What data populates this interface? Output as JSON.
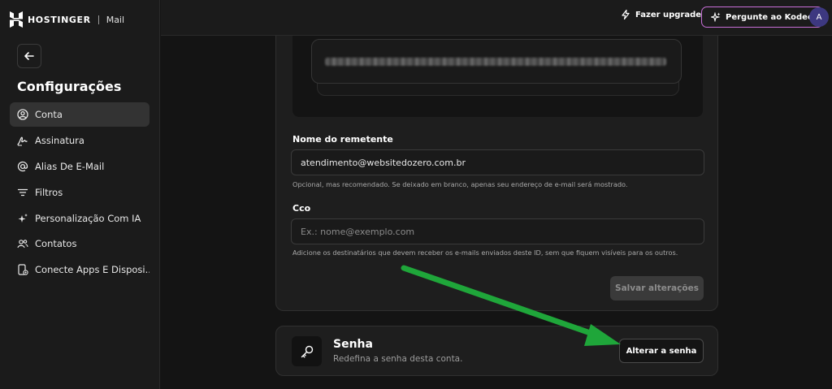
{
  "brand": {
    "name": "HOSTINGER",
    "product": "Mail"
  },
  "sidebar": {
    "title": "Configurações",
    "items": [
      {
        "label": "Conta",
        "icon": "user-circle-icon",
        "active": true
      },
      {
        "label": "Assinatura",
        "icon": "signature-icon",
        "active": false
      },
      {
        "label": "Alias De E-Mail",
        "icon": "at-icon",
        "active": false
      },
      {
        "label": "Filtros",
        "icon": "filter-icon",
        "active": false
      },
      {
        "label": "Personalização Com IA",
        "icon": "sparkles-icon",
        "active": false
      },
      {
        "label": "Contatos",
        "icon": "contacts-icon",
        "active": false
      },
      {
        "label": "Conecte Apps E Disposi...",
        "icon": "device-icon",
        "active": false
      }
    ]
  },
  "topbar": {
    "upgrade_label": "Fazer upgrade",
    "kodee_label": "Pergunte ao Kodee",
    "avatar_initial": "A",
    "accent": "#c86fd8"
  },
  "form": {
    "sender_label": "Nome do remetente",
    "sender_value": "atendimento@websitedozero.com.br",
    "sender_hint": "Opcional, mas recomendado. Se deixado em branco, apenas seu endereço de e-mail será mostrado.",
    "cco_label": "Cco",
    "cco_placeholder": "Ex.: nome@exemplo.com",
    "cco_hint": "Adicione os destinatários que devem receber os e-mails enviados deste ID, sem que fiquem visíveis para os outros.",
    "save_label": "Salvar alterações"
  },
  "password": {
    "title": "Senha",
    "subtitle": "Redefina a senha desta conta.",
    "button_label": "Alterar a senha"
  },
  "annotation": {
    "arrow_color": "#1fa63a"
  }
}
